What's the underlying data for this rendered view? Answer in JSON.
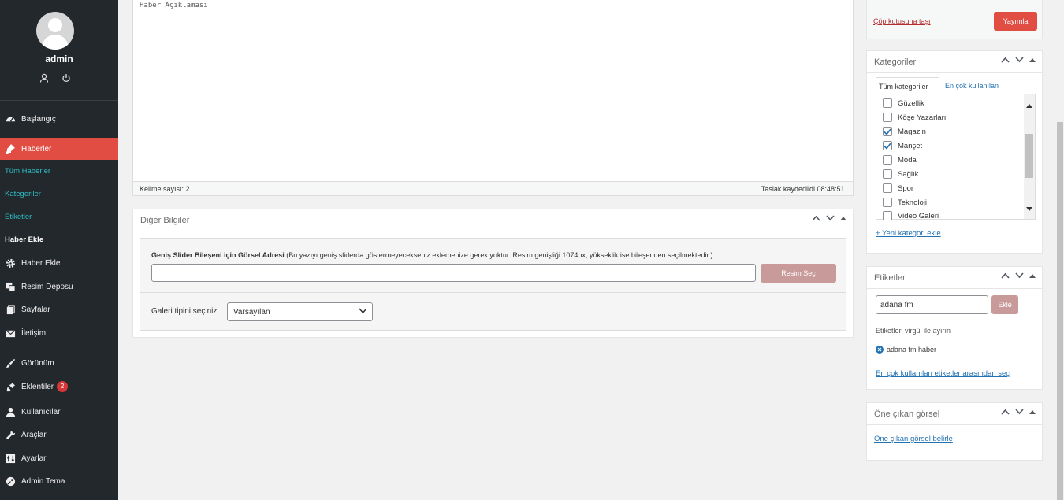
{
  "sidebar": {
    "user": {
      "name": "admin"
    },
    "menu": [
      {
        "label": "Başlangıç",
        "icon": "dashboard-icon"
      },
      {
        "label": "Haberler",
        "icon": "pin-icon",
        "active": true
      },
      {
        "label": "Haber Ekle",
        "icon": "gear-icon"
      },
      {
        "label": "Resim Deposu",
        "icon": "media-icon"
      },
      {
        "label": "Sayfalar",
        "icon": "pages-icon"
      },
      {
        "label": "İletişim",
        "icon": "mail-icon"
      },
      {
        "label": "Görünüm",
        "icon": "brush-icon"
      },
      {
        "label": "Eklentiler",
        "icon": "plugin-icon",
        "badge": "2"
      },
      {
        "label": "Kullanıcılar",
        "icon": "users-icon"
      },
      {
        "label": "Araçlar",
        "icon": "wrench-icon"
      },
      {
        "label": "Ayarlar",
        "icon": "settings-icon"
      },
      {
        "label": "Admin Tema",
        "icon": "palette-icon"
      }
    ],
    "submenu": [
      "Tüm Haberler",
      "Kategoriler",
      "Etiketler",
      "Haber Ekle"
    ]
  },
  "editor": {
    "content": "Haber Açıklaması",
    "word_count": "Kelime sayısı: 2",
    "draft_saved": "Taslak kaydedildi 08:48:51."
  },
  "diger": {
    "title": "Diğer Bilgiler",
    "slider_label_bold": "Geniş Slider Bileşeni için Görsel Adresi",
    "slider_label_note": " (Bu yazıyı geniş sliderda göstermeyecekseniz eklemenize gerek yoktur. Resim genişliği 1074px, yükseklik ise bileşenden seçilmektedir.)",
    "slider_value": "",
    "select_image_button": "Resim Seç",
    "gallery_label": "Galeri tipini seçiniz",
    "gallery_selected": "Varsayılan"
  },
  "publish": {
    "trash_link": "Çöp kutusuna taşı",
    "publish_button": "Yayımla"
  },
  "categories": {
    "title": "Kategoriler",
    "tab_all": "Tüm kategoriler",
    "tab_popular": "En çok kullanılan",
    "items": [
      {
        "label": "Güzellik",
        "checked": false
      },
      {
        "label": "Köşe Yazarları",
        "checked": false
      },
      {
        "label": "Magazin",
        "checked": true
      },
      {
        "label": "Manşet",
        "checked": true
      },
      {
        "label": "Moda",
        "checked": false
      },
      {
        "label": "Sağlık",
        "checked": false
      },
      {
        "label": "Spor",
        "checked": false
      },
      {
        "label": "Teknoloji",
        "checked": false
      },
      {
        "label": "Video Galeri",
        "checked": false
      }
    ],
    "new_category_link": "+ Yeni kategori ekle"
  },
  "tags": {
    "title": "Etiketler",
    "input_value": "adana fm",
    "add_button": "Ekle",
    "hint": "Etiketleri virgül ile ayırın",
    "chips": [
      "adana fm haber"
    ],
    "most_used_link": "En çok kullanılan etiketler arasından seç"
  },
  "featured": {
    "title": "Öne çıkan görsel",
    "set_link": "Öne çıkan görsel belirle"
  },
  "colors": {
    "sidebar_bg": "#23282d",
    "accent": "#e14d43",
    "link": "#2271b1",
    "submenu_link": "#2ebfc2"
  }
}
